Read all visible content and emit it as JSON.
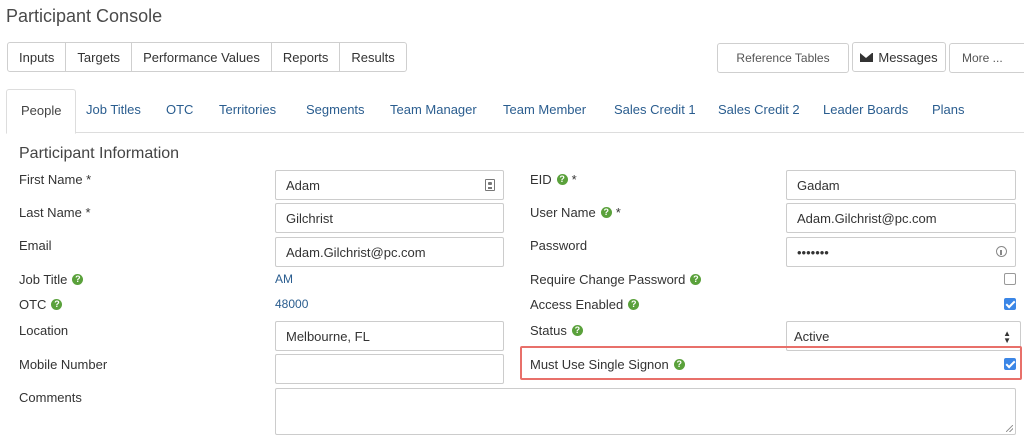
{
  "app": {
    "title": "Participant Console"
  },
  "toolbar": {
    "buttons": [
      "Inputs",
      "Targets",
      "Performance Values",
      "Reports",
      "Results"
    ],
    "reference_tables": "Reference Tables",
    "messages": "Messages",
    "more": "More ..."
  },
  "tabs": [
    "People",
    "Job Titles",
    "OTC",
    "Territories",
    "Segments",
    "Team Manager",
    "Team Member",
    "Sales Credit 1",
    "Sales Credit 2",
    "Leader Boards",
    "Plans"
  ],
  "section": {
    "title": "Participant Information"
  },
  "form": {
    "first_name": {
      "label": "First Name *",
      "value": "Adam"
    },
    "last_name": {
      "label": "Last Name *",
      "value": "Gilchrist"
    },
    "email": {
      "label": "Email",
      "value": "Adam.Gilchrist@pc.com"
    },
    "job_title": {
      "label": "Job Title",
      "value": "AM"
    },
    "otc": {
      "label": "OTC",
      "value": "48000"
    },
    "location": {
      "label": "Location",
      "value": "Melbourne, FL"
    },
    "mobile_number": {
      "label": "Mobile Number",
      "value": ""
    },
    "comments": {
      "label": "Comments",
      "value": ""
    },
    "eid": {
      "label": "EID",
      "star": "*",
      "value": "Gadam"
    },
    "user_name": {
      "label": "User Name",
      "star": "*",
      "value": "Adam.Gilchrist@pc.com"
    },
    "password": {
      "label": "Password",
      "value": "•••••••"
    },
    "require_change_password": {
      "label": "Require Change Password",
      "checked": false
    },
    "access_enabled": {
      "label": "Access Enabled",
      "checked": true
    },
    "status": {
      "label": "Status",
      "value": "Active"
    },
    "single_signon": {
      "label": "Must Use Single Signon",
      "checked": true
    }
  },
  "help_glyph": "?",
  "colors": {
    "link": "#2a5d8f",
    "help": "#5aa13b",
    "check": "#3b86e6",
    "highlight": "#e8706a"
  }
}
